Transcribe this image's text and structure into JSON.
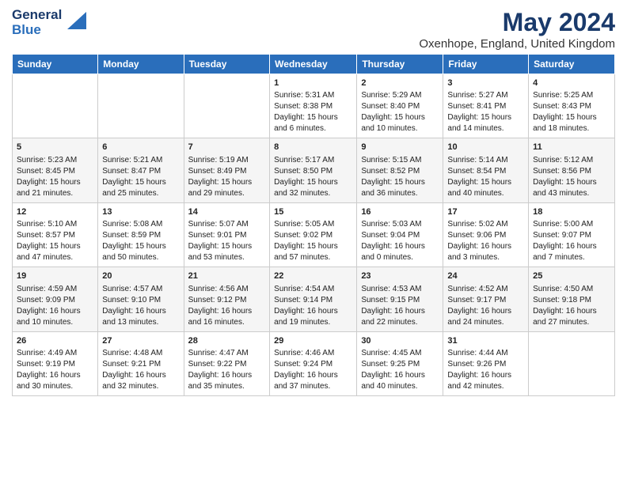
{
  "logo": {
    "line1": "General",
    "line2": "Blue"
  },
  "title": "May 2024",
  "subtitle": "Oxenhope, England, United Kingdom",
  "weekdays": [
    "Sunday",
    "Monday",
    "Tuesday",
    "Wednesday",
    "Thursday",
    "Friday",
    "Saturday"
  ],
  "weeks": [
    [
      {
        "day": "",
        "info": ""
      },
      {
        "day": "",
        "info": ""
      },
      {
        "day": "",
        "info": ""
      },
      {
        "day": "1",
        "info": "Sunrise: 5:31 AM\nSunset: 8:38 PM\nDaylight: 15 hours\nand 6 minutes."
      },
      {
        "day": "2",
        "info": "Sunrise: 5:29 AM\nSunset: 8:40 PM\nDaylight: 15 hours\nand 10 minutes."
      },
      {
        "day": "3",
        "info": "Sunrise: 5:27 AM\nSunset: 8:41 PM\nDaylight: 15 hours\nand 14 minutes."
      },
      {
        "day": "4",
        "info": "Sunrise: 5:25 AM\nSunset: 8:43 PM\nDaylight: 15 hours\nand 18 minutes."
      }
    ],
    [
      {
        "day": "5",
        "info": "Sunrise: 5:23 AM\nSunset: 8:45 PM\nDaylight: 15 hours\nand 21 minutes."
      },
      {
        "day": "6",
        "info": "Sunrise: 5:21 AM\nSunset: 8:47 PM\nDaylight: 15 hours\nand 25 minutes."
      },
      {
        "day": "7",
        "info": "Sunrise: 5:19 AM\nSunset: 8:49 PM\nDaylight: 15 hours\nand 29 minutes."
      },
      {
        "day": "8",
        "info": "Sunrise: 5:17 AM\nSunset: 8:50 PM\nDaylight: 15 hours\nand 32 minutes."
      },
      {
        "day": "9",
        "info": "Sunrise: 5:15 AM\nSunset: 8:52 PM\nDaylight: 15 hours\nand 36 minutes."
      },
      {
        "day": "10",
        "info": "Sunrise: 5:14 AM\nSunset: 8:54 PM\nDaylight: 15 hours\nand 40 minutes."
      },
      {
        "day": "11",
        "info": "Sunrise: 5:12 AM\nSunset: 8:56 PM\nDaylight: 15 hours\nand 43 minutes."
      }
    ],
    [
      {
        "day": "12",
        "info": "Sunrise: 5:10 AM\nSunset: 8:57 PM\nDaylight: 15 hours\nand 47 minutes."
      },
      {
        "day": "13",
        "info": "Sunrise: 5:08 AM\nSunset: 8:59 PM\nDaylight: 15 hours\nand 50 minutes."
      },
      {
        "day": "14",
        "info": "Sunrise: 5:07 AM\nSunset: 9:01 PM\nDaylight: 15 hours\nand 53 minutes."
      },
      {
        "day": "15",
        "info": "Sunrise: 5:05 AM\nSunset: 9:02 PM\nDaylight: 15 hours\nand 57 minutes."
      },
      {
        "day": "16",
        "info": "Sunrise: 5:03 AM\nSunset: 9:04 PM\nDaylight: 16 hours\nand 0 minutes."
      },
      {
        "day": "17",
        "info": "Sunrise: 5:02 AM\nSunset: 9:06 PM\nDaylight: 16 hours\nand 3 minutes."
      },
      {
        "day": "18",
        "info": "Sunrise: 5:00 AM\nSunset: 9:07 PM\nDaylight: 16 hours\nand 7 minutes."
      }
    ],
    [
      {
        "day": "19",
        "info": "Sunrise: 4:59 AM\nSunset: 9:09 PM\nDaylight: 16 hours\nand 10 minutes."
      },
      {
        "day": "20",
        "info": "Sunrise: 4:57 AM\nSunset: 9:10 PM\nDaylight: 16 hours\nand 13 minutes."
      },
      {
        "day": "21",
        "info": "Sunrise: 4:56 AM\nSunset: 9:12 PM\nDaylight: 16 hours\nand 16 minutes."
      },
      {
        "day": "22",
        "info": "Sunrise: 4:54 AM\nSunset: 9:14 PM\nDaylight: 16 hours\nand 19 minutes."
      },
      {
        "day": "23",
        "info": "Sunrise: 4:53 AM\nSunset: 9:15 PM\nDaylight: 16 hours\nand 22 minutes."
      },
      {
        "day": "24",
        "info": "Sunrise: 4:52 AM\nSunset: 9:17 PM\nDaylight: 16 hours\nand 24 minutes."
      },
      {
        "day": "25",
        "info": "Sunrise: 4:50 AM\nSunset: 9:18 PM\nDaylight: 16 hours\nand 27 minutes."
      }
    ],
    [
      {
        "day": "26",
        "info": "Sunrise: 4:49 AM\nSunset: 9:19 PM\nDaylight: 16 hours\nand 30 minutes."
      },
      {
        "day": "27",
        "info": "Sunrise: 4:48 AM\nSunset: 9:21 PM\nDaylight: 16 hours\nand 32 minutes."
      },
      {
        "day": "28",
        "info": "Sunrise: 4:47 AM\nSunset: 9:22 PM\nDaylight: 16 hours\nand 35 minutes."
      },
      {
        "day": "29",
        "info": "Sunrise: 4:46 AM\nSunset: 9:24 PM\nDaylight: 16 hours\nand 37 minutes."
      },
      {
        "day": "30",
        "info": "Sunrise: 4:45 AM\nSunset: 9:25 PM\nDaylight: 16 hours\nand 40 minutes."
      },
      {
        "day": "31",
        "info": "Sunrise: 4:44 AM\nSunset: 9:26 PM\nDaylight: 16 hours\nand 42 minutes."
      },
      {
        "day": "",
        "info": ""
      }
    ]
  ]
}
